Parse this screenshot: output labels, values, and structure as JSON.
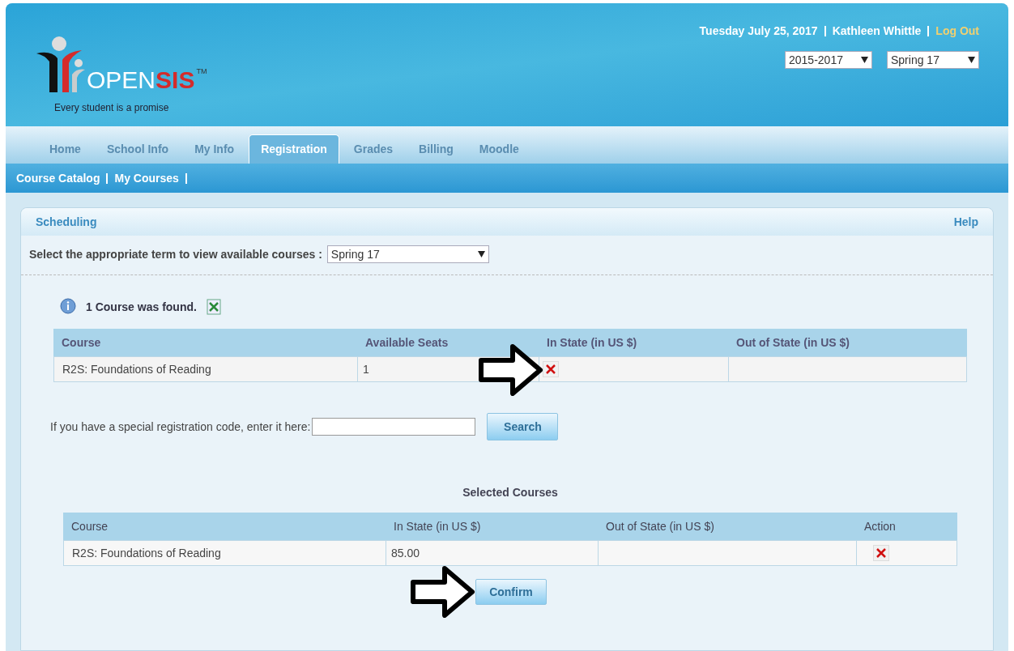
{
  "header": {
    "logo_text_open": "OPEN",
    "logo_text_sis": "SIS",
    "logo_tm": "TM",
    "tagline": "Every student is a promise",
    "date": "Tuesday July 25, 2017",
    "user": "Kathleen Whittle",
    "logout": "Log Out",
    "year_select": "2015-2017",
    "term_select": "Spring 17"
  },
  "tabs": [
    {
      "label": "Home",
      "selected": false
    },
    {
      "label": "School Info",
      "selected": false
    },
    {
      "label": "My Info",
      "selected": false
    },
    {
      "label": "Registration",
      "selected": true
    },
    {
      "label": "Grades",
      "selected": false
    },
    {
      "label": "Billing",
      "selected": false
    },
    {
      "label": "Moodle",
      "selected": false
    }
  ],
  "subnav": [
    "Course Catalog",
    "My Courses"
  ],
  "panel": {
    "title": "Scheduling",
    "help": "Help",
    "term_label": "Select the appropriate term to view available courses :",
    "term_value": "Spring 17",
    "found_text": "1 Course was found.",
    "courses_table": {
      "columns": [
        "Course",
        "Available Seats",
        "In State (in US $)",
        "Out of State (in US $)"
      ],
      "rows": [
        {
          "course": "R2S: Foundations of Reading",
          "seats": "1"
        }
      ]
    },
    "code_label": "If you have a special registration code, enter it here:",
    "search_button": "Search",
    "selected_title": "Selected Courses",
    "selected_table": {
      "columns": [
        "Course",
        "In State (in US $)",
        "Out of State (in US $)",
        "Action"
      ],
      "rows": [
        {
          "course": "R2S: Foundations of Reading",
          "in_state": "85.00"
        }
      ]
    },
    "confirm_button": "Confirm"
  }
}
